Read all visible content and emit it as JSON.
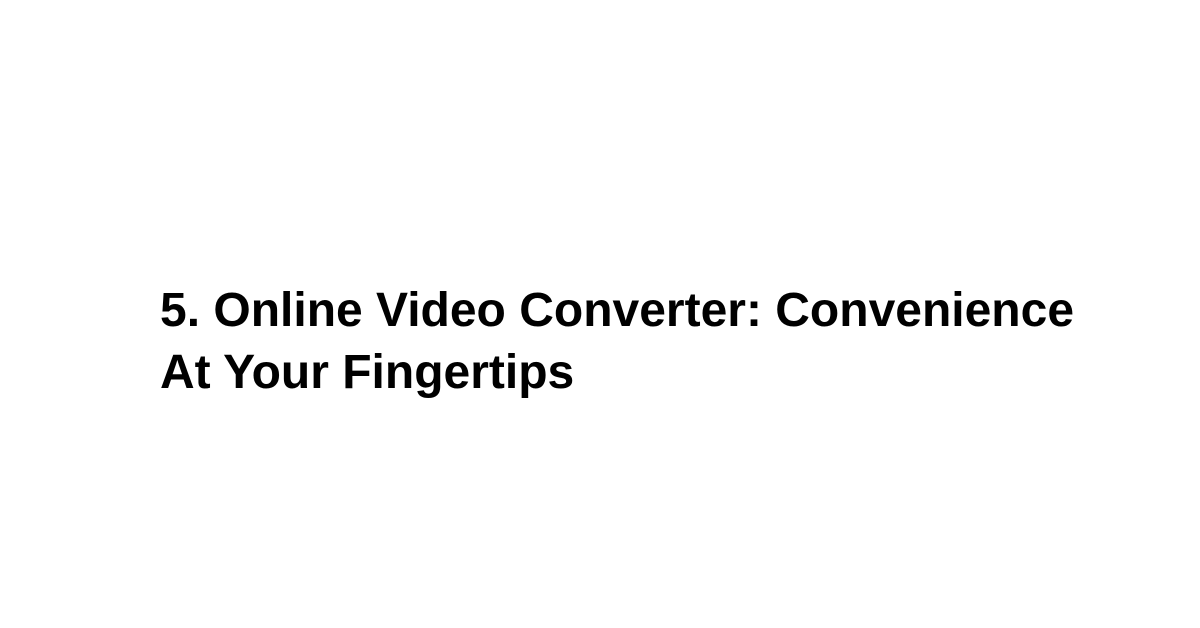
{
  "heading": {
    "text": "5. Online Video Converter: Convenience At Your Fingertips"
  }
}
